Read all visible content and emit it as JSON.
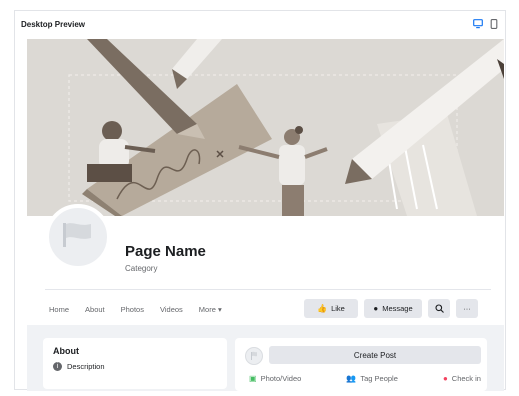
{
  "window": {
    "title": "Desktop Preview",
    "desktop_icon": "desktop-icon",
    "mobile_icon": "mobile-icon",
    "accent": "#1877f2"
  },
  "page": {
    "name": "Page Name",
    "category": "Category"
  },
  "tabs": [
    {
      "label": "Home"
    },
    {
      "label": "About"
    },
    {
      "label": "Photos"
    },
    {
      "label": "Videos"
    },
    {
      "label": "More ▾"
    }
  ],
  "actions": {
    "like_label": "Like",
    "message_label": "Message",
    "search_icon": "search-icon",
    "more_label": "···"
  },
  "about": {
    "title": "About",
    "description": "Description"
  },
  "post": {
    "create_label": "Create Post",
    "photo_video_label": "Photo/Video",
    "tag_people_label": "Tag People",
    "check_in_label": "Check in",
    "colors": {
      "photo_video": "#45bd62",
      "tag_people": "#1877f2",
      "check_in": "#f3425f"
    }
  }
}
